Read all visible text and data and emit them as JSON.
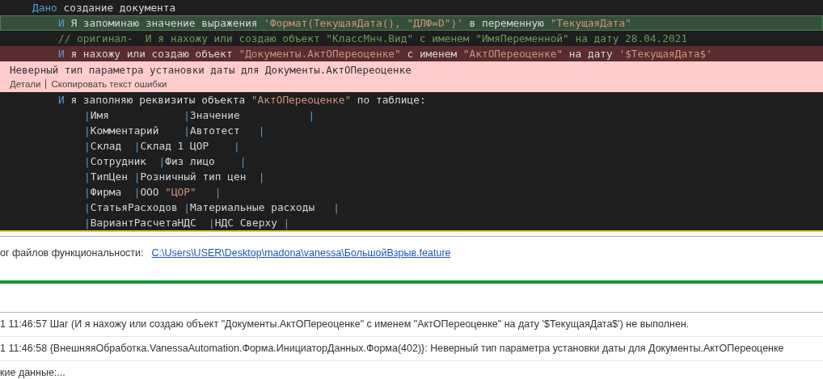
{
  "editor": {
    "lines": [
      {
        "passed": false,
        "failed": false,
        "tokens": [
          {
            "kind": "keyword",
            "text": "Дано"
          },
          {
            "kind": "plain",
            "text": " создание документа"
          }
        ],
        "children": [
          {
            "passed": true,
            "failed": false,
            "tokens": [
              {
                "kind": "keyword",
                "text": "И"
              },
              {
                "kind": "plain",
                "text": " Я запоминаю значение выражения "
              },
              {
                "kind": "string",
                "text": "'Формат(ТекущаяДата(), \"ДЛФ=D\")'"
              },
              {
                "kind": "plain",
                "text": " в переменную "
              },
              {
                "kind": "string",
                "text": "\"ТекущаяДата\""
              }
            ]
          },
          {
            "passed": false,
            "failed": false,
            "tokens": [
              {
                "kind": "comment",
                "text": "// оригинал-  И я нахожу или создаю объект \"КлассМнч.Вид\" с именем \"ИмяПеременной\" на дату 28.04.2021"
              }
            ]
          },
          {
            "passed": false,
            "failed": true,
            "tokens": [
              {
                "kind": "keyword",
                "text": "И"
              },
              {
                "kind": "plain",
                "text": " я нахожу или создаю объект "
              },
              {
                "kind": "string",
                "text": "\"Документы.АктОПереоценке\""
              },
              {
                "kind": "plain",
                "text": " с именем "
              },
              {
                "kind": "string",
                "text": "\"АктОПереоценке\""
              },
              {
                "kind": "plain",
                "text": " на дату "
              },
              {
                "kind": "string",
                "text": "'$ТекущаяДата$'"
              }
            ],
            "error": {
              "message": "Неверный тип параметра установки даты для Документы.АктОПереоценке",
              "actions": [
                "Детали",
                "Скопировать текст ошибки"
              ]
            }
          },
          {
            "passed": false,
            "failed": false,
            "tokens": [
              {
                "kind": "keyword",
                "text": "И"
              },
              {
                "kind": "plain",
                "text": " я заполняю реквизиты объекта "
              },
              {
                "kind": "string",
                "text": "\"АктОПереоценке\""
              },
              {
                "kind": "plain",
                "text": " по таблице:"
              }
            ],
            "children": [
              {
                "passed": false,
                "failed": false,
                "tokens": [
                  {
                    "kind": "pipe",
                    "text": "|"
                  },
                  {
                    "kind": "plain",
                    "text": "Имя            "
                  },
                  {
                    "kind": "pipe",
                    "text": "|"
                  },
                  {
                    "kind": "plain",
                    "text": "Значение           "
                  },
                  {
                    "kind": "pipe",
                    "text": "|"
                  }
                ]
              },
              {
                "passed": false,
                "failed": false,
                "tokens": [
                  {
                    "kind": "pipe",
                    "text": "|"
                  },
                  {
                    "kind": "plain",
                    "text": "Комментарий    "
                  },
                  {
                    "kind": "pipe",
                    "text": "|"
                  },
                  {
                    "kind": "plain",
                    "text": "Автотест   "
                  },
                  {
                    "kind": "pipe",
                    "text": "|"
                  }
                ]
              },
              {
                "passed": false,
                "failed": false,
                "tokens": [
                  {
                    "kind": "pipe",
                    "text": "|"
                  },
                  {
                    "kind": "plain",
                    "text": "Склад  "
                  },
                  {
                    "kind": "pipe",
                    "text": "|"
                  },
                  {
                    "kind": "plain",
                    "text": "Склад 1 ЦОР    "
                  },
                  {
                    "kind": "pipe",
                    "text": "|"
                  }
                ]
              },
              {
                "passed": false,
                "failed": false,
                "tokens": [
                  {
                    "kind": "pipe",
                    "text": "|"
                  },
                  {
                    "kind": "plain",
                    "text": "Сотрудник  "
                  },
                  {
                    "kind": "pipe",
                    "text": "|"
                  },
                  {
                    "kind": "plain",
                    "text": "Физ лицо    "
                  },
                  {
                    "kind": "pipe",
                    "text": "|"
                  }
                ]
              },
              {
                "passed": false,
                "failed": false,
                "tokens": [
                  {
                    "kind": "pipe",
                    "text": "|"
                  },
                  {
                    "kind": "plain",
                    "text": "ТипЦен "
                  },
                  {
                    "kind": "pipe",
                    "text": "|"
                  },
                  {
                    "kind": "plain",
                    "text": "Розничный тип цен  "
                  },
                  {
                    "kind": "pipe",
                    "text": "|"
                  }
                ]
              },
              {
                "passed": false,
                "failed": false,
                "tokens": [
                  {
                    "kind": "pipe",
                    "text": "|"
                  },
                  {
                    "kind": "plain",
                    "text": "Фирма  "
                  },
                  {
                    "kind": "pipe",
                    "text": "|"
                  },
                  {
                    "kind": "plain",
                    "text": "ООО "
                  },
                  {
                    "kind": "string",
                    "text": "\"ЦОР\"   "
                  },
                  {
                    "kind": "pipe",
                    "text": "|"
                  }
                ]
              },
              {
                "passed": false,
                "failed": false,
                "tokens": [
                  {
                    "kind": "pipe",
                    "text": "|"
                  },
                  {
                    "kind": "plain",
                    "text": "СтатьяРасходов "
                  },
                  {
                    "kind": "pipe",
                    "text": "|"
                  },
                  {
                    "kind": "plain",
                    "text": "Материальные расходы   "
                  },
                  {
                    "kind": "pipe",
                    "text": "|"
                  }
                ]
              },
              {
                "passed": false,
                "failed": false,
                "tokens": [
                  {
                    "kind": "pipe",
                    "text": "|"
                  },
                  {
                    "kind": "plain",
                    "text": "ВариантРасчетаНДС  "
                  },
                  {
                    "kind": "pipe",
                    "text": "|"
                  },
                  {
                    "kind": "plain",
                    "text": "НДС Сверху "
                  },
                  {
                    "kind": "pipe",
                    "text": "|"
                  }
                ]
              }
            ]
          }
        ]
      }
    ]
  },
  "log": {
    "label": "ог файлов функциональности:",
    "path": "C:\\Users\\USER\\Desktop\\madona\\vanessa\\БольшойВзрыв.feature",
    "messages": [
      "1 11:46:57 Шаг (И я нахожу или создаю объект \"Документы.АктОПереоценке\" с именем \"АктОПереоценке\" на дату '$ТекущаяДата$') не выполнен.",
      "1 11:46:58 {ВнешняяОбработка.VanessaAutomation.Форма.ИнициаторДанных.Форма(402)}: Неверный тип параметра установки даты для Документы.АктОПереоценке",
      "кие данные:..."
    ]
  }
}
